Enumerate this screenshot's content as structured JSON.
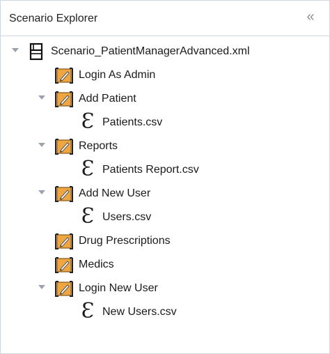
{
  "panel": {
    "title": "Scenario Explorer",
    "collapse_glyph": "«"
  },
  "tree": {
    "root": {
      "label": "Scenario_PatientManagerAdvanced.xml",
      "icon": "document-icon"
    },
    "items": [
      {
        "label": "Login As Admin",
        "icon": "test-case-icon"
      },
      {
        "label": "Add Patient",
        "icon": "test-case-icon",
        "datasource": {
          "label": "Patients.csv",
          "icon": "datasource-icon"
        }
      },
      {
        "label": "Reports",
        "icon": "test-case-icon",
        "datasource": {
          "label": "Patients Report.csv",
          "icon": "datasource-icon"
        }
      },
      {
        "label": "Add New User",
        "icon": "test-case-icon",
        "datasource": {
          "label": "Users.csv",
          "icon": "datasource-icon"
        }
      },
      {
        "label": "Drug Prescriptions",
        "icon": "test-case-icon"
      },
      {
        "label": "Medics",
        "icon": "test-case-icon"
      },
      {
        "label": "Login New User",
        "icon": "test-case-icon",
        "datasource": {
          "label": "New Users.csv",
          "icon": "datasource-icon"
        }
      }
    ],
    "datasource_glyph": "Ɛ"
  }
}
